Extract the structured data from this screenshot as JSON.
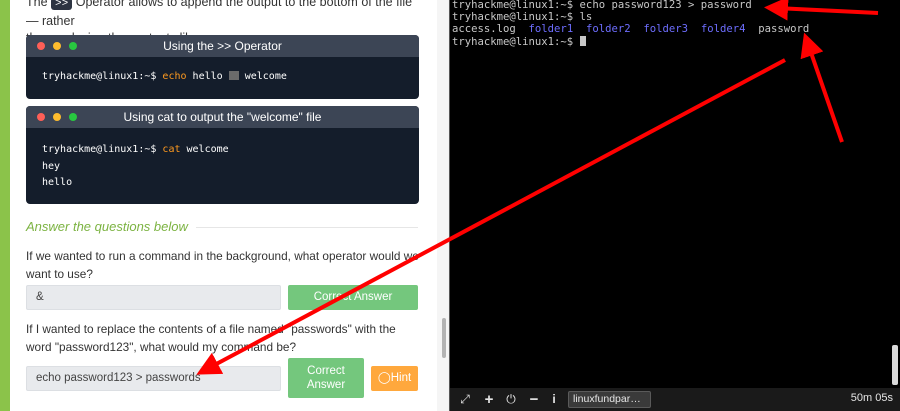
{
  "intro": {
    "line1_a": "The",
    "line1_code": ">>",
    "line1_b": "Operator allows to append the output to the bottom of the file — rather",
    "line2": "than replacing the contents like so:"
  },
  "term1": {
    "title": "Using the >> Operator",
    "prompt": "tryhackme@linux1:~$",
    "cmd": "echo",
    "text_a": "hello",
    "text_b": "welcome"
  },
  "term2": {
    "title": "Using cat to output the \"welcome\" file",
    "prompt": "tryhackme@linux1:~$",
    "cmd": "cat",
    "arg": "welcome",
    "out1": "hey",
    "out2": "hello"
  },
  "answers": {
    "heading": "Answer the questions below",
    "q1": "If we wanted to run a command in the background, what operator would we want to use?",
    "q1_answer": "&",
    "q1_button": "Correct Answer",
    "q2": "If I wanted to replace the contents of a file named \"passwords\" with the word \"password123\", what would my command be?",
    "q2_answer": "echo password123 > passwords",
    "q2_button": "Correct Answer",
    "hint_button": "Hint"
  },
  "vterm": {
    "line1": "tryhackme@linux1:~$ echo password123 > password",
    "line2": "tryhackme@linux1:~$ ls",
    "ls_file1": "access.log",
    "ls_dirs": [
      "folder1",
      "folder2",
      "folder3",
      "folder4"
    ],
    "ls_file2": "password",
    "line4": "tryhackme@linux1:~$ "
  },
  "taskbar": {
    "tab_label": "linuxfundpar…",
    "timer": "50m 05s"
  },
  "colors": {
    "accent_green": "#8bc34a",
    "button_green": "#74c77d",
    "hint_orange": "#ffa83d",
    "terminal_dir_blue": "#6d6dfd",
    "arrow_red": "#ff0000"
  }
}
